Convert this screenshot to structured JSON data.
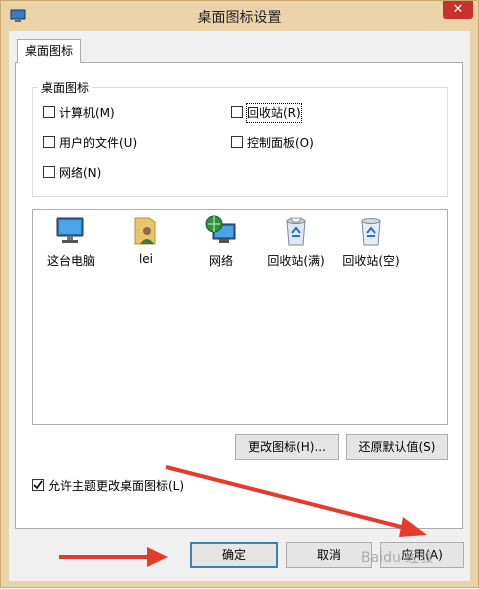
{
  "window": {
    "title": "桌面图标设置",
    "close_glyph": "✕"
  },
  "tabs": [
    {
      "label": "桌面图标"
    }
  ],
  "group": {
    "legend": "桌面图标",
    "checkboxes": [
      {
        "label": "计算机(M)",
        "checked": false
      },
      {
        "label": "回收站(R)",
        "checked": false
      },
      {
        "label": "用户的文件(U)",
        "checked": false
      },
      {
        "label": "控制面板(O)",
        "checked": false
      },
      {
        "label": "网络(N)",
        "checked": false
      }
    ]
  },
  "icons": [
    {
      "label": "这台电脑",
      "icon": "computer-icon"
    },
    {
      "label": "lei",
      "icon": "user-folder-icon"
    },
    {
      "label": "网络",
      "icon": "network-globe-icon"
    },
    {
      "label": "回收站(满)",
      "icon": "recycle-bin-full-icon"
    },
    {
      "label": "回收站(空)",
      "icon": "recycle-bin-empty-icon"
    }
  ],
  "buttons": {
    "change_icon": "更改图标(H)...",
    "restore_default": "还原默认值(S)",
    "ok": "确定",
    "cancel": "取消",
    "apply": "应用(A)"
  },
  "allow_themes": {
    "label": "允许主题更改桌面图标(L)",
    "checked": true
  },
  "watermark": "Baidu 经验",
  "colors": {
    "accent_border": "#3c7fb1",
    "annotation_arrow": "#e53a2c",
    "frame": "#ebd3a9"
  }
}
